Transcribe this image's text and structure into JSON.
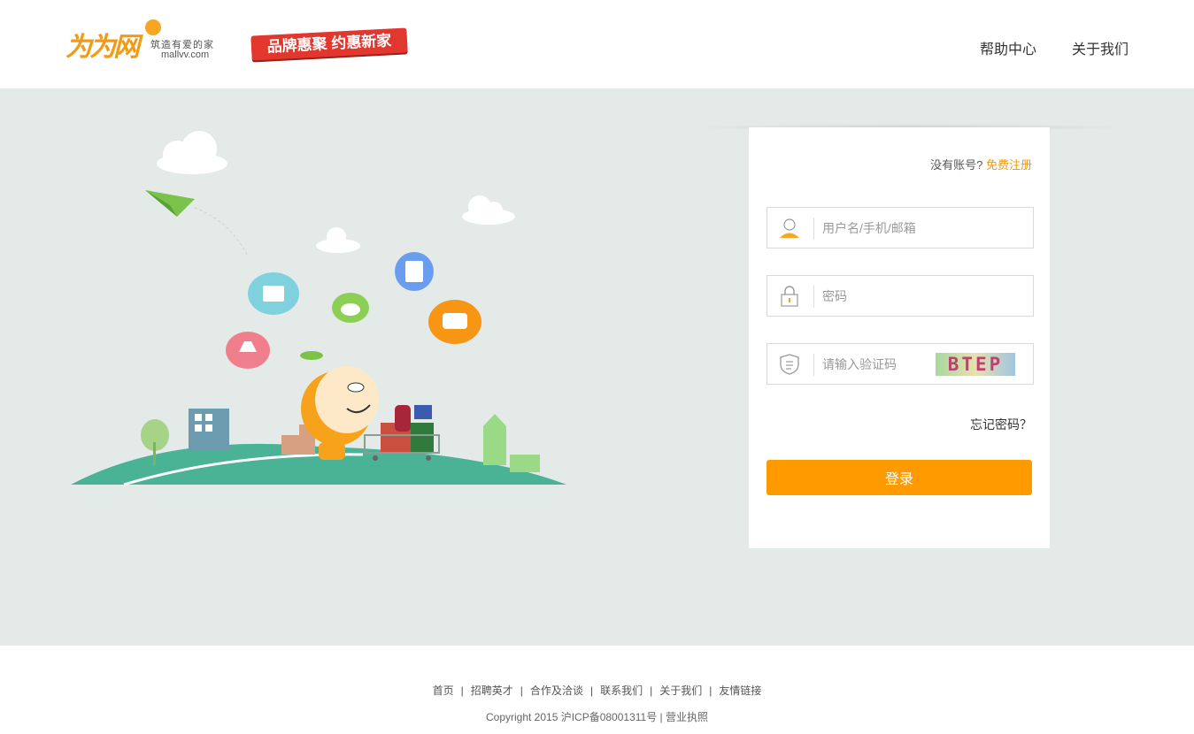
{
  "header": {
    "logo_mark": "为为网",
    "logo_slogan": "筑造有爱的家",
    "logo_domain": "mallvv.com",
    "banner_text": "品牌惠聚 约惠新家",
    "nav": [
      "帮助中心",
      "关于我们"
    ]
  },
  "login": {
    "no_account": "没有账号?",
    "register_link": "免费注册",
    "username_placeholder": "用户名/手机/邮箱",
    "password_placeholder": "密码",
    "captcha_placeholder": "请输入验证码",
    "captcha_text": "BTEP",
    "forgot": "忘记密码？",
    "submit": "登录"
  },
  "footer": {
    "links": [
      "首页",
      "招聘英才",
      "合作及洽谈",
      "联系我们",
      "关于我们",
      "友情链接"
    ],
    "copyright": "Copyright 2015 沪ICP备08001311号 | 营业执照"
  },
  "colors": {
    "accent": "#ff9a00",
    "background_band": "#e3eae8",
    "hill": "#4ab396"
  }
}
